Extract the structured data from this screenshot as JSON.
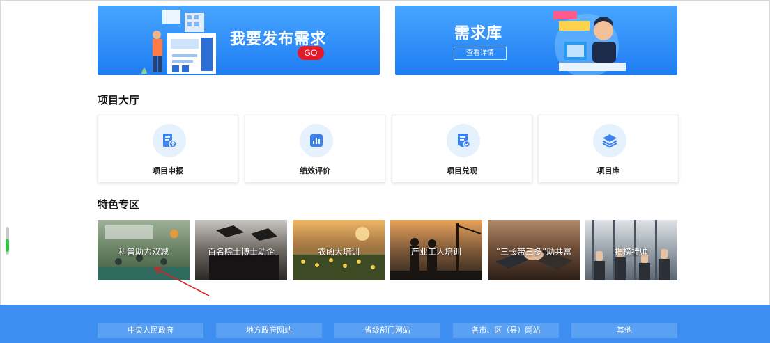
{
  "banners": {
    "publish": {
      "title": "我要发布需求",
      "go_label": "GO"
    },
    "library": {
      "title": "需求库",
      "detail_label": "查看详情"
    }
  },
  "hall": {
    "title": "项目大厅",
    "cards": [
      {
        "label": "项目申报",
        "icon": "document-upload-icon"
      },
      {
        "label": "绩效评价",
        "icon": "bar-chart-icon"
      },
      {
        "label": "项目兑现",
        "icon": "check-document-icon"
      },
      {
        "label": "项目库",
        "icon": "layers-icon"
      }
    ]
  },
  "featured": {
    "title": "特色专区",
    "tiles": [
      {
        "label": "科普助力双减"
      },
      {
        "label": "百名院士博士助企"
      },
      {
        "label": "农函大培训"
      },
      {
        "label": "产业工人培训"
      },
      {
        "label": "“三长带三多”助共富"
      },
      {
        "label": "揭榜挂帅"
      }
    ]
  },
  "footer": {
    "links": [
      "中央人民政府",
      "地方政府网站",
      "省级部门网站",
      "各市、区（县）网站",
      "其他"
    ]
  },
  "colors": {
    "banner_blue": "#1e7df3",
    "go_red": "#e21b2a",
    "footer_blue": "#3d8ef0",
    "annotation_red": "#e02020"
  }
}
